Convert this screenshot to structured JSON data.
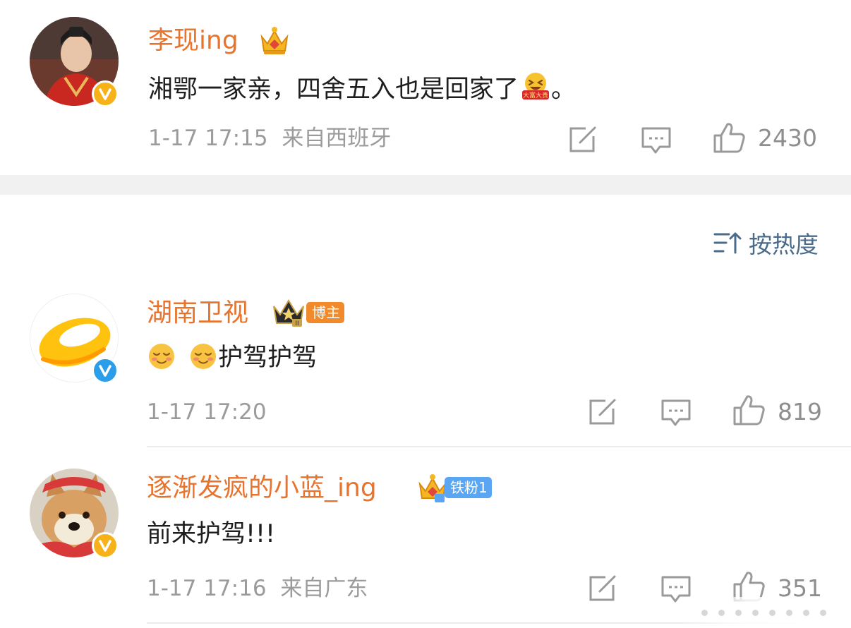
{
  "post": {
    "author": "李现ing",
    "text": "湘鄂一家亲，四舍五入也是回家了",
    "emoji_label": "大富大贵",
    "text_end": "。",
    "time": "1-17 17:15",
    "source": "来自西班牙",
    "likes": "2430"
  },
  "sort": {
    "label": "按热度"
  },
  "comments": [
    {
      "author": "湖南卫视",
      "badge": "博主",
      "text": "护驾护驾",
      "time": "1-17 17:20",
      "source": "",
      "likes": "819"
    },
    {
      "author": "逐渐发疯的小蓝_ing",
      "badge": "铁粉1",
      "text": "前来护驾!!!",
      "time": "1-17 17:16",
      "source": "来自广东",
      "likes": "351"
    }
  ],
  "colors": {
    "username": "#e8732c",
    "meta": "#9b9b9b",
    "sort": "#4a6b8a",
    "fan_badge": "#5aa6f2",
    "blogger_badge": "#f08a2a",
    "verified_gold": "#f7b21a",
    "verified_blue": "#2a9ee8"
  }
}
